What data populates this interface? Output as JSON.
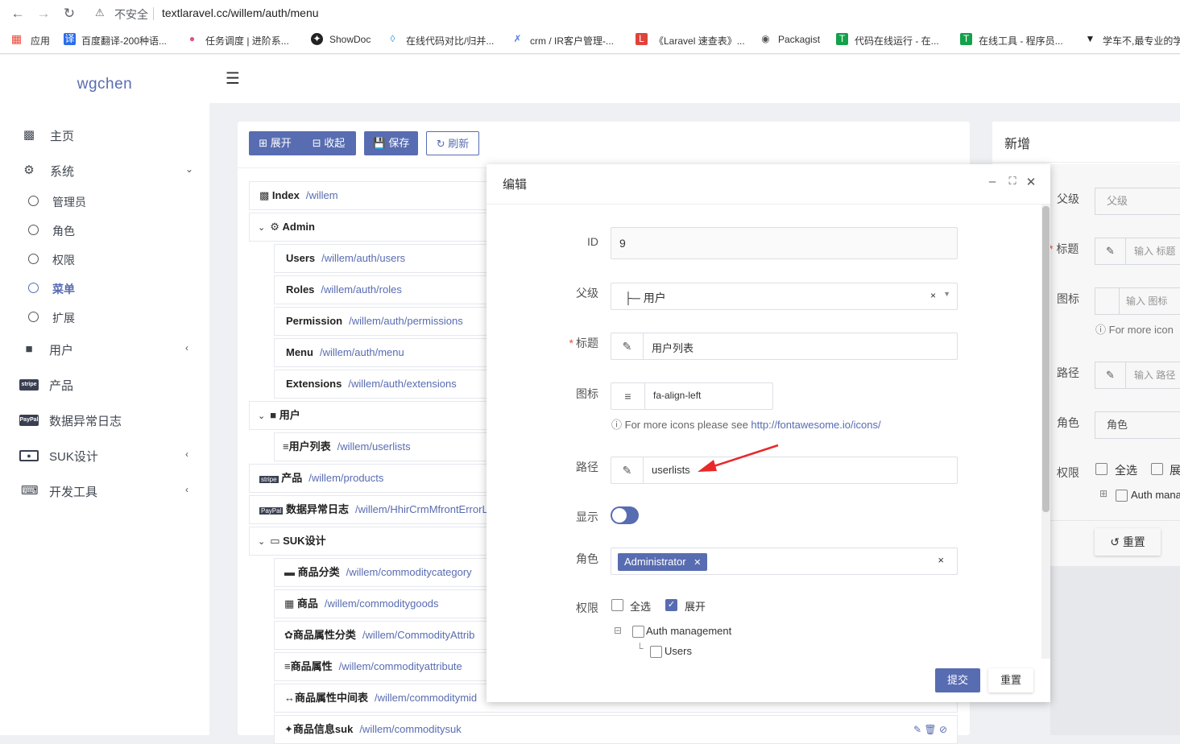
{
  "browser": {
    "insecure": "不安全",
    "url": "textlaravel.cc/willem/auth/menu",
    "bookmarks": [
      "应用",
      "百度翻译-200种语...",
      "任务调度 | 进阶系...",
      "ShowDoc",
      "在线代码对比/归并...",
      "crm / IR客户管理-...",
      "《Laravel 速查表》...",
      "Packagist",
      "代码在线运行 - 在...",
      "在线工具 - 程序员...",
      "学车不,最专业的学"
    ]
  },
  "sidebar": {
    "brand": "wgchen",
    "items": [
      {
        "label": "主页"
      },
      {
        "label": "系统"
      },
      {
        "label": "用户"
      },
      {
        "label": "产品"
      },
      {
        "label": "数据异常日志"
      },
      {
        "label": "SUK设计"
      },
      {
        "label": "开发工具"
      }
    ],
    "sub": [
      {
        "label": "管理员"
      },
      {
        "label": "角色"
      },
      {
        "label": "权限"
      },
      {
        "label": "菜单"
      },
      {
        "label": "扩展"
      }
    ]
  },
  "toolbar": {
    "expand": "展开",
    "collapse": "收起",
    "save": "保存",
    "refresh": "刷新"
  },
  "tree": [
    {
      "title": "Index",
      "path": "/willem"
    },
    {
      "title": "Admin",
      "path": ""
    },
    {
      "title": "Users",
      "path": "/willem/auth/users"
    },
    {
      "title": "Roles",
      "path": "/willem/auth/roles"
    },
    {
      "title": "Permission",
      "path": "/willem/auth/permissions"
    },
    {
      "title": "Menu",
      "path": "/willem/auth/menu"
    },
    {
      "title": "Extensions",
      "path": "/willem/auth/extensions"
    },
    {
      "title": "用户",
      "path": ""
    },
    {
      "title": "用户列表",
      "path": "/willem/userlists"
    },
    {
      "title": "产品",
      "path": "/willem/products"
    },
    {
      "title": "数据异常日志",
      "path": "/willem/HhirCrmMfrontErrorL"
    },
    {
      "title": "SUK设计",
      "path": ""
    },
    {
      "title": "商品分类",
      "path": "/willem/commoditycategory"
    },
    {
      "title": "商品",
      "path": "/willem/commoditygoods"
    },
    {
      "title": "商品属性分类",
      "path": "/willem/CommodityAttrib"
    },
    {
      "title": "商品属性",
      "path": "/willem/commodityattribute"
    },
    {
      "title": "商品属性中间表",
      "path": "/willem/commoditymid"
    },
    {
      "title": "商品信息suk",
      "path": "/willem/commoditysuk"
    }
  ],
  "new_panel": {
    "title": "新增",
    "parent_label": "父级",
    "parent_placeholder": "父级",
    "title_label": "标题",
    "title_placeholder": "输入 标题",
    "icon_label": "图标",
    "icon_placeholder": "输入 图标",
    "icon_help": "For more icon",
    "path_label": "路径",
    "path_placeholder": "输入 路径",
    "role_label": "角色",
    "role_placeholder": "角色",
    "perm_label": "权限",
    "select_all": "全选",
    "expand": "展",
    "auth_node": "Auth mana",
    "reset": "重置"
  },
  "modal": {
    "title": "编辑",
    "id_label": "ID",
    "id_value": "9",
    "parent_label": "父级",
    "parent_value": "├─ 用户",
    "title_label": "标题",
    "title_value": "用户列表",
    "icon_label": "图标",
    "icon_value": "fa-align-left",
    "icon_help_prefix": "For more icons please see ",
    "icon_help_link": "http://fontawesome.io/icons/",
    "path_label": "路径",
    "path_value": "userlists",
    "show_label": "显示",
    "role_label": "角色",
    "role_tag": "Administrator",
    "perm_label": "权限",
    "select_all": "全选",
    "expand": "展开",
    "perm_node": "Auth management",
    "perm_child": "Users",
    "submit": "提交",
    "reset": "重置",
    "show_enabled": true
  },
  "colors": {
    "accent": "#586cb1",
    "annotation_arrow": "#e8282b"
  }
}
